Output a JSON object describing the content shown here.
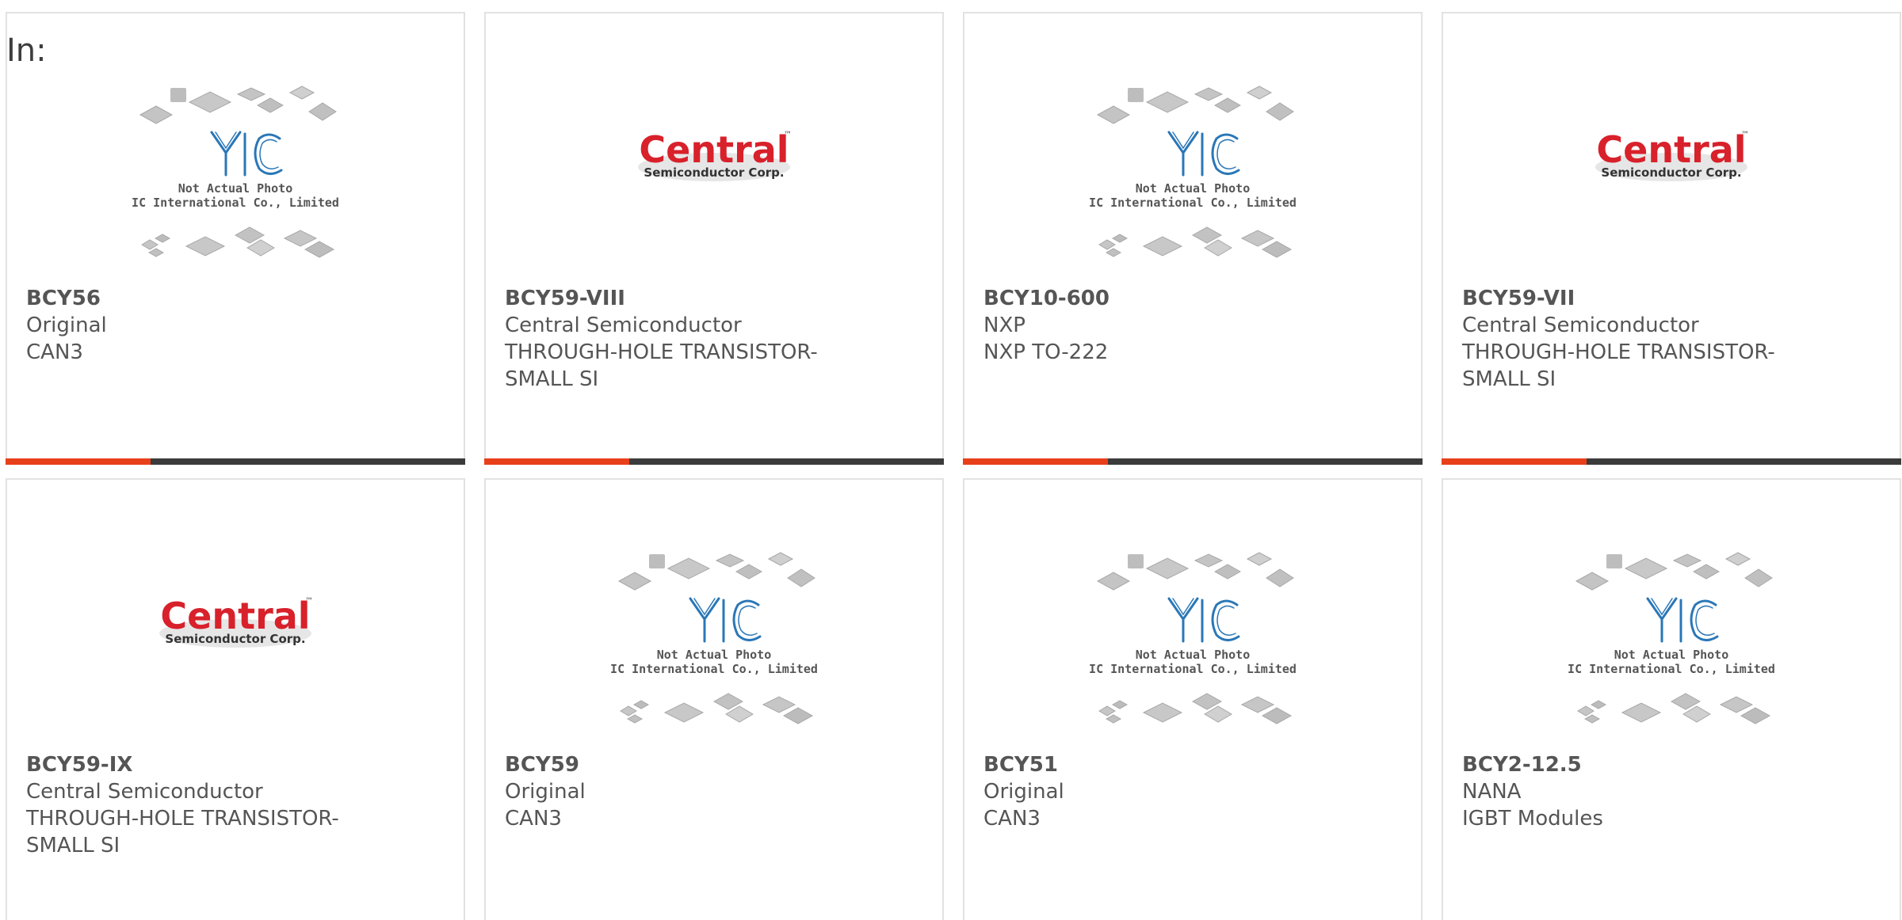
{
  "filter_label": "In:",
  "placeholder": {
    "line1": "Not Actual Photo",
    "line2": "YIC International Co., Limited."
  },
  "central_logo": {
    "word": "Central",
    "sub": "Semiconductor Corp.",
    "tm": "™"
  },
  "colors": {
    "accent": "#e8401a",
    "bar": "#3b3b3b",
    "yic_blue": "#2a77b7",
    "central_red": "#d8212b"
  },
  "products": [
    {
      "part": "BCY56",
      "maker": "Original",
      "desc1": "CAN3",
      "desc2": "",
      "image": "yic-placeholder"
    },
    {
      "part": "BCY59-VIII",
      "maker": "Central Semiconductor",
      "desc1": "THROUGH-HOLE TRANSISTOR-",
      "desc2": "SMALL SI",
      "image": "central-logo"
    },
    {
      "part": "BCY10-600",
      "maker": "NXP",
      "desc1": "NXP TO-222",
      "desc2": "",
      "image": "yic-placeholder"
    },
    {
      "part": "BCY59-VII",
      "maker": "Central Semiconductor",
      "desc1": "THROUGH-HOLE TRANSISTOR-",
      "desc2": "SMALL SI",
      "image": "central-logo"
    },
    {
      "part": "BCY59-IX",
      "maker": "Central Semiconductor",
      "desc1": "THROUGH-HOLE TRANSISTOR-",
      "desc2": "SMALL SI",
      "image": "central-logo"
    },
    {
      "part": "BCY59",
      "maker": "Original",
      "desc1": "CAN3",
      "desc2": "",
      "image": "yic-placeholder"
    },
    {
      "part": "BCY51",
      "maker": "Original",
      "desc1": "CAN3",
      "desc2": "",
      "image": "yic-placeholder"
    },
    {
      "part": "BCY2-12.5",
      "maker": "NANA",
      "desc1": "IGBT Modules",
      "desc2": "",
      "image": "yic-placeholder"
    }
  ]
}
